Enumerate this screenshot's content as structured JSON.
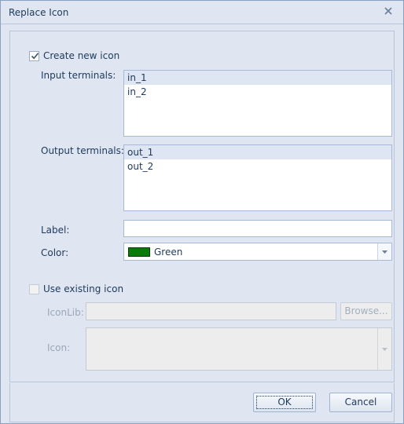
{
  "window": {
    "title": "Replace Icon",
    "close_icon": "close-x-icon"
  },
  "create_new": {
    "checkbox_label": "Create new icon",
    "checked": true,
    "input_terminals_label": "Input terminals:",
    "input_terminals": [
      "in_1",
      "in_2"
    ],
    "output_terminals_label": "Output terminals:",
    "output_terminals": [
      "out_1",
      "out_2"
    ],
    "label_label": "Label:",
    "label_value": "",
    "color_label": "Color:",
    "color_value": "Green",
    "color_swatch": "#0a7a0a"
  },
  "use_existing": {
    "checkbox_label": "Use existing icon",
    "checked": false,
    "iconlib_label": "IconLib:",
    "iconlib_value": "",
    "browse_label": "Browse...",
    "icon_label": "Icon:"
  },
  "footer": {
    "ok_label": "OK",
    "cancel_label": "Cancel"
  }
}
